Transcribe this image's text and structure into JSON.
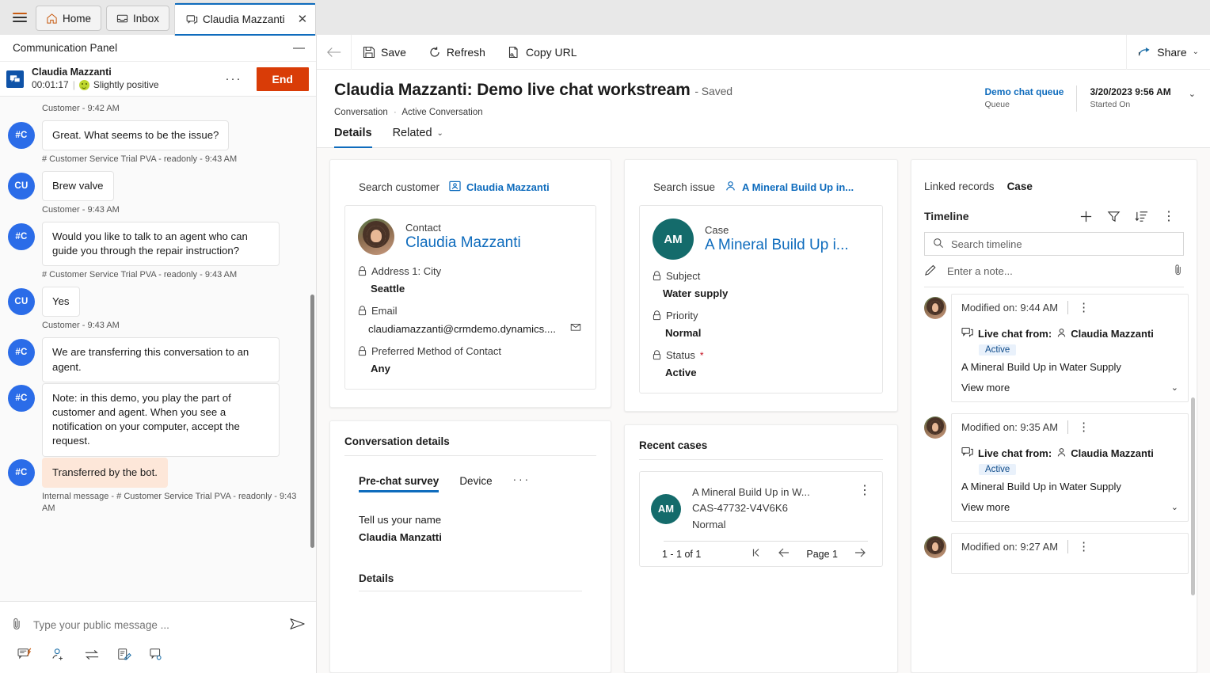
{
  "tabstrip": {
    "menu_icon": "hamburger-icon",
    "tabs": [
      {
        "label": "Home",
        "icon": "home-icon",
        "active": false
      },
      {
        "label": "Inbox",
        "icon": "inbox-icon",
        "active": false
      },
      {
        "label": "Claudia Mazzanti",
        "icon": "chat-icon",
        "active": true,
        "close": "✕"
      }
    ]
  },
  "communication_panel": {
    "title": "Communication Panel",
    "minimize_label": "—",
    "conversation": {
      "name": "Claudia Mazzanti",
      "timer": "00:01:17",
      "separator": "|",
      "sentiment": "Slightly positive",
      "overflow_label": "···",
      "end_label": "End"
    },
    "messages": [
      {
        "kind": "stamp",
        "text": "Customer - 9:42 AM"
      },
      {
        "kind": "msg",
        "avatar": "#C",
        "text": "Great. What seems to be the issue?",
        "internal": false
      },
      {
        "kind": "stamp",
        "text": "# Customer Service Trial PVA - readonly - 9:43 AM"
      },
      {
        "kind": "msg",
        "avatar": "CU",
        "text": "Brew valve",
        "internal": false
      },
      {
        "kind": "stamp",
        "text": "Customer - 9:43 AM"
      },
      {
        "kind": "msg",
        "avatar": "#C",
        "text": "Would you like to talk to an agent who can guide you through the repair instruction?",
        "internal": false
      },
      {
        "kind": "stamp",
        "text": "# Customer Service Trial PVA - readonly - 9:43 AM"
      },
      {
        "kind": "msg",
        "avatar": "CU",
        "text": "Yes",
        "internal": false
      },
      {
        "kind": "stamp",
        "text": "Customer - 9:43 AM"
      },
      {
        "kind": "msg",
        "avatar": "#C",
        "text": "We are transferring this conversation to an agent.",
        "internal": false
      },
      {
        "kind": "msg",
        "avatar": "#C",
        "text": "Note: in this demo, you play the part of customer and agent. When you see a notification on your computer, accept the request.",
        "internal": false
      },
      {
        "kind": "msg",
        "avatar": "#C",
        "text": "Transferred by the bot.",
        "internal": true
      },
      {
        "kind": "stamp",
        "text": "Internal message - # Customer Service Trial PVA - readonly - 9:43 AM"
      }
    ],
    "composer": {
      "attach_icon": "paperclip-icon",
      "placeholder": "Type your public message ...",
      "send_icon": "send-icon",
      "tools": [
        {
          "name": "quick-replies-icon"
        },
        {
          "name": "agent-consult-icon"
        },
        {
          "name": "transfer-icon"
        },
        {
          "name": "notes-icon"
        },
        {
          "name": "linked-conversation-icon"
        }
      ]
    }
  },
  "command_bar": {
    "back_icon": "back-arrow-icon",
    "commands": [
      {
        "label": "Save",
        "icon": "save-icon"
      },
      {
        "label": "Refresh",
        "icon": "refresh-icon"
      },
      {
        "label": "Copy URL",
        "icon": "copy-url-icon"
      }
    ],
    "share_label": "Share",
    "share_icon": "share-icon",
    "share_chevron": "⌄"
  },
  "record_header": {
    "title": "Claudia Mazzanti: Demo live chat workstream",
    "saved_suffix": "- Saved",
    "breadcrumb_entity": "Conversation",
    "breadcrumb_sep": "·",
    "breadcrumb_view": "Active Conversation",
    "fields": [
      {
        "value": "Demo chat queue",
        "label": "Queue",
        "link": true
      },
      {
        "value": "3/20/2023 9:56 AM",
        "label": "Started On",
        "link": false
      }
    ],
    "expand_chevron": "⌄"
  },
  "form_tabs": [
    {
      "label": "Details",
      "active": true
    },
    {
      "label": "Related",
      "active": false,
      "chevron": "⌄"
    }
  ],
  "customer_card": {
    "search_label": "Search customer",
    "search_value": "Claudia Mazzanti",
    "search_icon": "contact-card-icon",
    "entity_kind": "Contact",
    "entity_name": "Claudia Mazzanti",
    "avatar": "contact-photo",
    "fields": [
      {
        "label": "Address 1: City",
        "value": "Seattle",
        "locked": true,
        "action_icon": null
      },
      {
        "label": "Email",
        "value": "claudiamazzanti@crmdemo.dynamics....",
        "locked": true,
        "action_icon": "send-email-icon"
      },
      {
        "label": "Preferred Method of Contact",
        "value": "Any",
        "locked": true,
        "action_icon": null
      }
    ]
  },
  "issue_card": {
    "search_label": "Search issue",
    "search_value": "A Mineral Build Up in...",
    "search_icon": "person-icon",
    "entity_kind": "Case",
    "entity_initials": "AM",
    "entity_name": "A Mineral Build Up i...",
    "fields": [
      {
        "label": "Subject",
        "value": "Water supply",
        "locked": true,
        "required": false
      },
      {
        "label": "Priority",
        "value": "Normal",
        "locked": true,
        "required": false
      },
      {
        "label": "Status",
        "value": "Active",
        "locked": true,
        "required": true,
        "req_mark": "*"
      }
    ]
  },
  "conversation_details": {
    "heading": "Conversation details",
    "subtabs": [
      {
        "label": "Pre-chat survey",
        "active": true
      },
      {
        "label": "Device",
        "active": false
      },
      {
        "label": "···",
        "active": false,
        "is_overflow": true
      }
    ],
    "survey": {
      "question": "Tell us your name",
      "answer": "Claudia Manzatti"
    },
    "details_heading": "Details"
  },
  "recent_cases": {
    "heading": "Recent cases",
    "items": [
      {
        "initials": "AM",
        "title": "A Mineral Build Up in W...",
        "number": "CAS-47732-V4V6K6",
        "priority": "Normal",
        "kebab": "⋮"
      }
    ],
    "pager": {
      "count": "1 - 1 of 1",
      "first_icon": "first-page-icon",
      "prev_icon": "previous-page-icon",
      "page_label": "Page 1",
      "next_icon": "next-page-icon"
    }
  },
  "timeline_panel": {
    "linked_records_label": "Linked records",
    "linked_records_value": "Case",
    "title": "Timeline",
    "actions": [
      {
        "name": "add-icon",
        "glyph": "+"
      },
      {
        "name": "filter-icon",
        "glyph": "filter"
      },
      {
        "name": "sort-icon",
        "glyph": "sort"
      },
      {
        "name": "more-commands-icon",
        "glyph": "⋮"
      }
    ],
    "search_placeholder": "Search timeline",
    "search_icon": "search-icon",
    "note_placeholder": "Enter a note...",
    "note_icon": "pencil-icon",
    "note_attach_icon": "paperclip-icon",
    "items": [
      {
        "modified": "Modified on: 9:44 AM",
        "kebab": "⋮",
        "channel_icon": "live-chat-icon",
        "from_label": "Live chat from:",
        "person_icon": "person-icon",
        "person": "Claudia Mazzanti",
        "status": "Active",
        "description": "A Mineral Build Up in Water Supply",
        "view_more": "View more",
        "view_more_chevron": "⌄"
      },
      {
        "modified": "Modified on: 9:35 AM",
        "kebab": "⋮",
        "channel_icon": "live-chat-icon",
        "from_label": "Live chat from:",
        "person_icon": "person-icon",
        "person": "Claudia Mazzanti",
        "status": "Active",
        "description": "A Mineral Build Up in Water Supply",
        "view_more": "View more",
        "view_more_chevron": "⌄"
      },
      {
        "modified": "Modified on: 9:27 AM",
        "kebab": "⋮",
        "channel_icon": "live-chat-icon",
        "from_label": "",
        "person_icon": "person-icon",
        "person": "",
        "status": "",
        "description": "",
        "view_more": "",
        "view_more_chevron": ""
      }
    ]
  },
  "colors": {
    "accent": "#0f6cbd",
    "end_button": "#d93c07",
    "avatar_blue": "#2b6ce8",
    "case_teal": "#146b6b",
    "internal_msg": "#fde7d9",
    "canvas": "#faf9f8"
  }
}
